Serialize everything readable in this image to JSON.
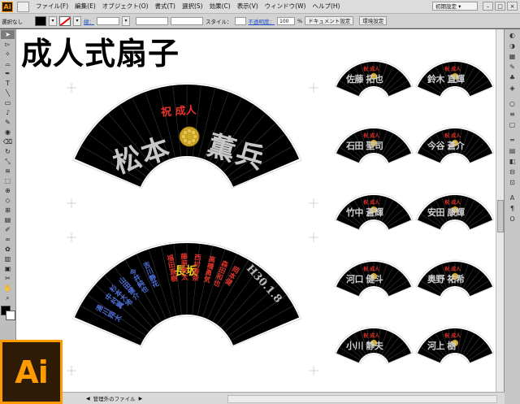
{
  "menubar": {
    "app_badge": "Ai",
    "items": [
      "ファイル(F)",
      "編集(E)",
      "オブジェクト(O)",
      "書式(T)",
      "選択(S)",
      "効果(C)",
      "表示(V)",
      "ウィンドウ(W)",
      "ヘルプ(H)"
    ],
    "workspace": "初期設定 ▾",
    "win_min": "–",
    "win_max": "□",
    "win_close": "×"
  },
  "control_bar": {
    "selection": "選択なし",
    "stroke_label": "線：",
    "style_label": "スタイル：",
    "opacity_label": "不透明度：",
    "opacity_value": "100",
    "opacity_unit": "%",
    "doc_setup": "ドキュメント設定",
    "preferences": "環境設定",
    "stroke_value": ""
  },
  "document": {
    "title": "成人式扇子",
    "main_fan": {
      "header": "祝 成人",
      "name_left": "松本",
      "name_right": "薫兵"
    },
    "group_fan": {
      "header": "長坂",
      "date": "H30.1.8",
      "columns": [
        {
          "text": "湯川翔太",
          "color": "#4d6fd6"
        },
        {
          "text": "中村翼",
          "color": "#4d6fd6"
        },
        {
          "text": "杉本大地",
          "color": "#4d6fd6"
        },
        {
          "text": "山田健介",
          "color": "#4d6fd6"
        },
        {
          "text": "今井純也",
          "color": "#4d6fd6"
        },
        {
          "text": "吉川静花",
          "color": "#4d6fd6"
        },
        {
          "text": "福田直樹",
          "color": "#d9342b"
        },
        {
          "text": "藤原亮太",
          "color": "#d9342b"
        },
        {
          "text": "西村香奈",
          "color": "#d9342b"
        },
        {
          "text": "高橋勇気",
          "color": "#d9342b"
        },
        {
          "text": "森田和也",
          "color": "#d9342b"
        },
        {
          "text": "岡本健",
          "color": "#d9342b"
        }
      ]
    },
    "small_fans": [
      {
        "header": "祝 成人",
        "name": "佐藤 拓也"
      },
      {
        "header": "祝 成人",
        "name": "鈴木 直輝"
      },
      {
        "header": "祝 成人",
        "name": "石田 聖司"
      },
      {
        "header": "祝 成人",
        "name": "今谷 蒼介"
      },
      {
        "header": "祝 成人",
        "name": "竹中 蒼輝"
      },
      {
        "header": "祝 成人",
        "name": "安田 康輝"
      },
      {
        "header": "祝 成人",
        "name": "河口 健斗"
      },
      {
        "header": "祝 成人",
        "name": "奥野 祐希"
      },
      {
        "header": "祝 成人",
        "name": "小川 静夫"
      },
      {
        "header": "祝 成人",
        "name": "河上 樹"
      }
    ]
  },
  "statusbar": {
    "zoom_arrow": "◀",
    "label": "管理外のファイル",
    "nav_arrow": "▶"
  },
  "colors": {
    "fan_black": "#000000",
    "fan_header_red": "#e8322b",
    "fan_header_yellow": "#f2d21b",
    "gold_crest": "#d4aa22",
    "ai_orange": "#ff9a00",
    "ai_bg": "#2d1b06"
  },
  "icons": {
    "toolbox": [
      "selection-icon",
      "direct-selection-icon",
      "magic-wand-icon",
      "lasso-icon",
      "pen-icon",
      "type-icon",
      "line-icon",
      "rectangle-icon",
      "paintbrush-icon",
      "pencil-icon",
      "blob-brush-icon",
      "eraser-icon",
      "rotate-icon",
      "scale-icon",
      "width-icon",
      "free-transform-icon",
      "shape-builder-icon",
      "perspective-icon",
      "mesh-icon",
      "gradient-icon",
      "eyedropper-icon",
      "blend-icon",
      "symbol-sprayer-icon",
      "column-graph-icon",
      "artboard-icon",
      "slice-icon",
      "hand-icon",
      "zoom-icon"
    ],
    "dock": [
      "color-icon",
      "color-guide-icon",
      "swatches-icon",
      "brushes-icon",
      "symbols-icon",
      "graphic-styles-icon",
      "appearance-icon",
      "layers-icon",
      "artboards-icon",
      "stroke-icon",
      "gradient-panel-icon",
      "transparency-icon",
      "align-icon",
      "transform-icon",
      "character-icon",
      "paragraph-icon",
      "opentype-icon"
    ]
  }
}
